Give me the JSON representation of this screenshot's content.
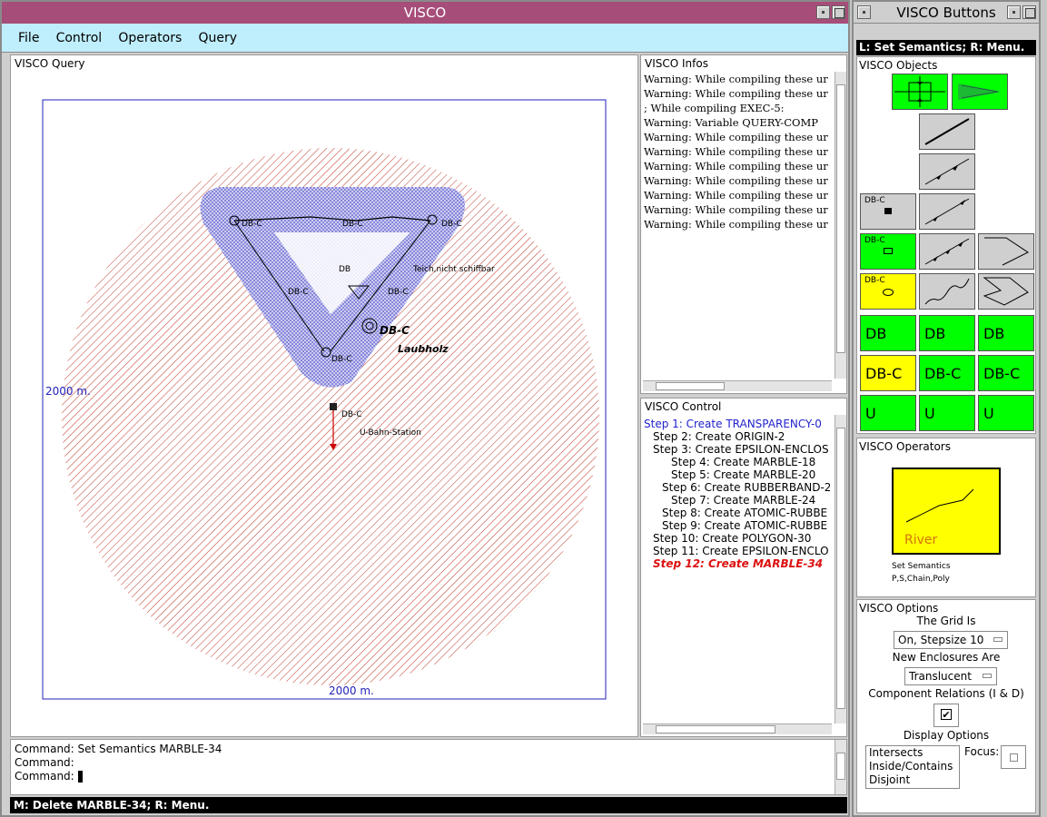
{
  "main_window": {
    "title": "VISCO",
    "titlebar_color": "#a64d79",
    "menu": [
      "File",
      "Control",
      "Operators",
      "Query"
    ],
    "menubar_color": "#bfeefc"
  },
  "query_pane": {
    "label": "VISCO Query",
    "scale_left": "2000 m.",
    "scale_bottom": "2000 m.",
    "scale_color": "#2222bb",
    "labels": {
      "dbc_1": "DB-C",
      "dbc_2": "DB-C",
      "dbc_3": "DB-C",
      "dbc_4": "DB-C",
      "db_center": "DB",
      "dbc_5": "DB-C",
      "teich": "Teich,nicht schiffbar",
      "dbc_big": "DB-C",
      "laubholz": "Laubholz",
      "dbc_6": "DB-C",
      "dbc_station": "DB-C",
      "station": "U-Bahn-Station"
    }
  },
  "infos_pane": {
    "label": "VISCO Infos",
    "lines": [
      "Warning: While compiling these ur",
      "Warning: While compiling these ur",
      "; While compiling EXEC-5:",
      "Warning: Variable QUERY-COMP",
      "Warning: While compiling these ur",
      "Warning: While compiling these ur",
      "Warning: While compiling these ur",
      "Warning: While compiling these ur",
      "Warning: While compiling these ur",
      "Warning: While compiling these ur",
      "Warning: While compiling these ur"
    ]
  },
  "control_pane": {
    "label": "VISCO Control",
    "steps": [
      {
        "text": "Step 1: Create TRANSPARENCY-0",
        "indent": 0,
        "style": "blue"
      },
      {
        "text": "Step 2: Create ORIGIN-2",
        "indent": 1,
        "style": "normal"
      },
      {
        "text": "Step 3: Create EPSILON-ENCLOS",
        "indent": 1,
        "style": "normal"
      },
      {
        "text": "Step 4: Create MARBLE-18",
        "indent": 3,
        "style": "normal"
      },
      {
        "text": "Step 5: Create MARBLE-20",
        "indent": 3,
        "style": "normal"
      },
      {
        "text": "Step 6: Create RUBBERBAND-2",
        "indent": 2,
        "style": "normal"
      },
      {
        "text": "Step 7: Create MARBLE-24",
        "indent": 3,
        "style": "normal"
      },
      {
        "text": "Step 8: Create ATOMIC-RUBBE",
        "indent": 2,
        "style": "normal"
      },
      {
        "text": "Step 9: Create ATOMIC-RUBBE",
        "indent": 2,
        "style": "normal"
      },
      {
        "text": "Step 10: Create POLYGON-30",
        "indent": 1,
        "style": "normal"
      },
      {
        "text": "Step 11: Create EPSILON-ENCLO",
        "indent": 1,
        "style": "normal"
      },
      {
        "text": "Step 12: Create MARBLE-34",
        "indent": 1,
        "style": "red"
      }
    ]
  },
  "command_pane": {
    "lines": [
      "Command: Set Semantics MARBLE-34",
      "Command:",
      "Command:"
    ]
  },
  "status_bar": "M: Delete MARBLE-34; R: Menu.",
  "buttons_window": {
    "title": "VISCO Buttons",
    "hint": "L: Set Semantics; R: Menu.",
    "objects_label": "VISCO Objects",
    "small_label": "DB-C",
    "grid_buttons": [
      [
        "DB",
        "DB",
        "DB"
      ],
      [
        "DB-C",
        "DB-C",
        "DB-C"
      ],
      [
        "U",
        "U",
        "U"
      ]
    ],
    "operators_label": "VISCO Operators",
    "operator": {
      "name": "River",
      "caption1": "Set Semantics",
      "caption2": "P,S,Chain,Poly"
    },
    "options_label": "VISCO Options",
    "grid_label": "The Grid Is",
    "grid_value": "On, Stepsize 10",
    "enclosures_label": "New Enclosures Are",
    "enclosures_value": "Translucent",
    "component_label": "Component Relations (I & D)",
    "component_checked": true,
    "display_label": "Display Options",
    "display_items": [
      "Intersects",
      "Inside/Contains",
      "Disjoint"
    ],
    "focus_label": "Focus:"
  }
}
